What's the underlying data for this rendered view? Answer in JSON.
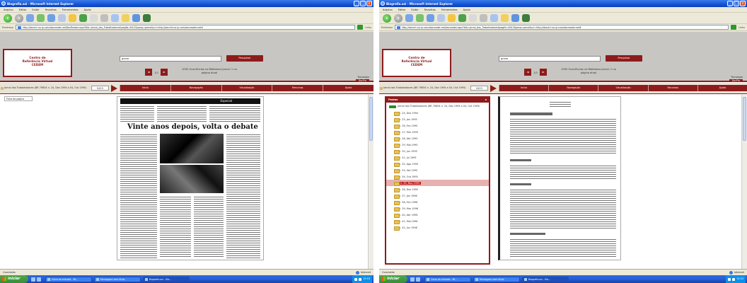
{
  "left_window": {
    "title": "Biografia.asi - Microsoft Internet Explorer",
    "menu": [
      "Arquivo",
      "Editar",
      "Exibir",
      "Favoritos",
      "Ferramentas",
      "Ajuda"
    ],
    "address_label": "Endereço",
    "address": "http://docvirt.no-ip.com/docreader.net/DocReader.aspx?bib=Jornal_dos_Trabalhadores&pagfis=6412&pesq=greve&url=http://docvirt.no-ip.com/docreader.net#",
    "links_label": "Links",
    "search_value": "greve",
    "search_button": "Pesquisar",
    "hits": "1/1",
    "info_text": "1092 Ocorrências na Biblioteca Jornal: 1 na página atual",
    "journal_title": "Jornal dos Trabalhadores (BR 79854 n. 24, Dez 1994 a 04, Out 1995)",
    "page_value": "0413",
    "status_left": "Concluído",
    "status_zone": "Internet",
    "newspaper_header": "Especial",
    "newspaper_headline": "Vinte anos depois, volta o debate"
  },
  "right_window": {
    "title": "Biografia.asi - Microsoft Internet Explorer",
    "menu": [
      "Arquivo",
      "Editar",
      "Exibir",
      "Favoritos",
      "Ferramentas",
      "Ajuda"
    ],
    "address_label": "Endereço",
    "address": "http://docvirt.no-ip.com/docreader.net/docreader.aspx?bib=Jornal_dos_Trabalhadores&pagfis=6412&pesq=greve&url=http://docvirt.no-ip.com/docreader.net#",
    "links_label": "Links",
    "search_value": "greve",
    "search_button": "Pesquisar",
    "hits": "1/1",
    "info_text": "1092 Ocorrências na Biblioteca Jornal: 1 na página atual",
    "journal_title": "Jornal dos Trabalhadores (BR 79854 n. 24, Dez 1994 a 04, Out 1995)",
    "page_value": "0413",
    "status_left": "Concluído",
    "status_zone": "Internet",
    "tree_title": "Pastas",
    "tree_root": "Jornal dos Trabalhadores (BR 79854 n. 24, Dez 1994 a 04, Out 1995)",
    "tree_items": [
      "n. 24, Dez 1994",
      "n. 25, Jan 1995",
      "n. 26, Fev 1995",
      "n. 27, Mar 1995",
      "n. 28, Abr 1995",
      "n. 29, Mai 1995",
      "n. 30, Jun 1995",
      "n. 31, Jul 1995",
      "n. 32, Ago 1995",
      "n. 33, Set 1995",
      "n. 34, Out 1995",
      "n. 35, Nov 1995",
      "n. 36, Dez 1995",
      "n. 37, Jan 1996",
      "n. 38, Fev 1996",
      "n. 39, Mar 1996",
      "n. 40, Abr 1996",
      "n. 41, Mai 1996",
      "n. 42, Jun 1996"
    ],
    "tree_selected_index": 11
  },
  "shared": {
    "logo_line1": "Centro de",
    "logo_line2": "Referência Virtual",
    "logo_line3": "CEDEM",
    "tabs": [
      "Início",
      "Navegação",
      "Visualização",
      "Recursos",
      "Ajuda"
    ],
    "brand_small": "Tecnologia",
    "brand_name": "DocPro"
  },
  "taskbar": {
    "start": "iniciar",
    "tasks": [
      "Caixa de entrada - Mi...",
      "Mensagem sem título",
      "Biografia.asi - Mic..."
    ],
    "active_index": 2,
    "clock": "15:53"
  },
  "colors": {
    "brand": "#8e1b1b",
    "xp_blue": "#245edb",
    "tray": "#0f8fe8"
  }
}
